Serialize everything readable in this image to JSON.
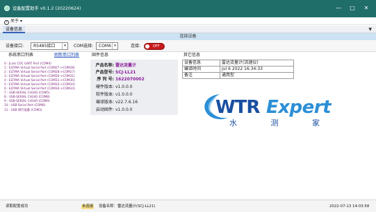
{
  "window": {
    "title": "设备配置助手 v0.1.2 (20220624)",
    "minimize": "—",
    "maximize": "□",
    "close": "✕"
  },
  "menu": {
    "about_label": "关于"
  },
  "tabs": [
    {
      "label": "设备信息",
      "active": true
    }
  ],
  "section_title": "连接设备",
  "toolbar": {
    "interface_label": "设备接口:",
    "interface_value": "RS485接口",
    "com_label": "COM选择:",
    "com_value": "COM6",
    "connect_label": "连接:",
    "toggle_text": "OFF",
    "toggle_state": "off"
  },
  "ports": {
    "title": "系统串口列表",
    "refresh_label": "刷新串口列表",
    "items": [
      "0 : JLink CDC UART Port (COM4)",
      "1 : ELTIMA Virtual Serial Port (COM27->COM28)",
      "2 : ELTIMA Virtual Serial Port (COM28->COM27)",
      "3 : ELTIMA Virtual Serial Port (COM30->COM31)",
      "4 : ELTIMA Virtual Serial Port (COM31->COM30)",
      "5 : ELTIMA Virtual Serial Port (COM33->COM34)",
      "6 : ELTIMA Virtual Serial Port (COM34->COM33)",
      "7 : USB-SERIAL CH340 (COM5)",
      "8 : USB-SERIAL CH340 (COM8)",
      "9 : USB-SERIAL CH340 (COM9)",
      "10 : USB Serial Port (COM6)",
      "11 : USB 串行设备 (COM3)"
    ]
  },
  "firmware": {
    "title": "固件信息",
    "rows": [
      {
        "key": "产品名称:",
        "value": "雷达流量计",
        "highlight": true
      },
      {
        "key": "产品型号:",
        "value": "SCJ-LL21",
        "highlight": true
      },
      {
        "key": "序 列 号:",
        "value": "1622070002",
        "highlight": true
      },
      {
        "key": "硬件版本:",
        "value": "v1.0.0.0",
        "highlight": false
      },
      {
        "key": "软件版本:",
        "value": "v1.0.0.0",
        "highlight": false
      },
      {
        "key": "编译版本:",
        "value": "v22.7.6.16",
        "highlight": false
      },
      {
        "key": "启动固件:",
        "value": "v1.0.0.0",
        "highlight": false
      }
    ]
  },
  "other": {
    "title": "其它信息",
    "rows": [
      {
        "key": "设备信息",
        "value": "雷达流量计(流速仪)"
      },
      {
        "key": "编译时间",
        "value": "Jul  6 2022 16:34:33"
      },
      {
        "key": "备注",
        "value": "通用型"
      }
    ]
  },
  "logo": {
    "wtr": "WTR",
    "expert": "Expert",
    "chinese": [
      "水",
      "测",
      "家"
    ]
  },
  "status": {
    "left": "读取配置成功",
    "warn": "未连接",
    "device": "设备名称：雷达流量计(SCJ-LL21)",
    "time": "2022-07-13 14:03:58"
  },
  "colors": {
    "titlebar": "#1f6e6a",
    "section": "#cde3f3",
    "toggle_off": "#c81a1a",
    "port_text": "#7a1f7a",
    "highlight_value": "#8a1c9a",
    "logo_dark": "#1a4fa0",
    "logo_light": "#2c8fd6"
  }
}
